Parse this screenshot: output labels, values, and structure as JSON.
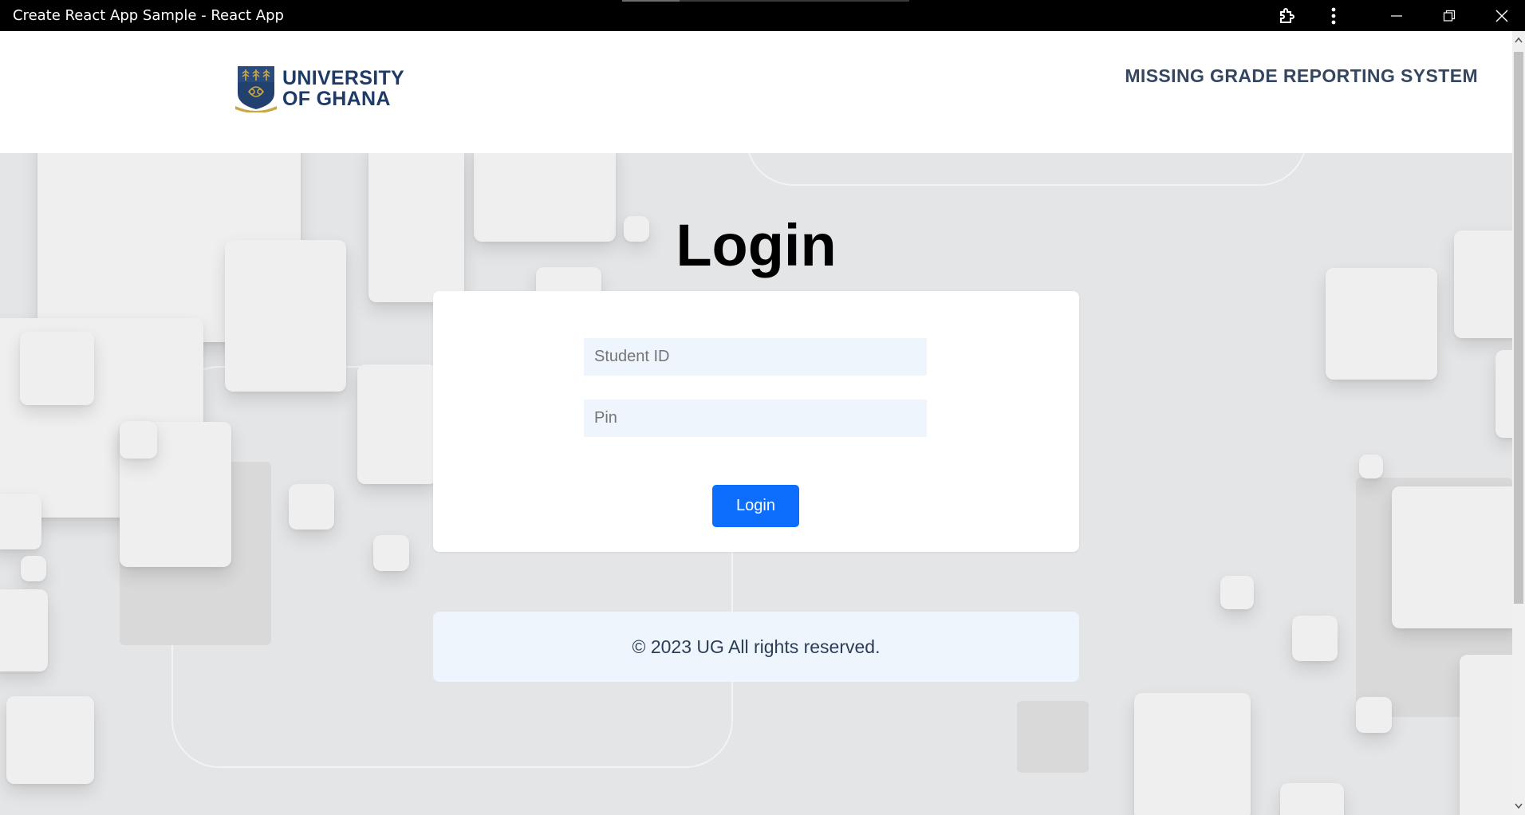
{
  "window": {
    "title": "Create React App Sample - React App",
    "icons": [
      "extensions-icon",
      "more-options-icon",
      "minimize-icon",
      "restore-icon",
      "close-icon"
    ]
  },
  "header": {
    "logo_line1": "UNIVERSITY",
    "logo_line2": "OF GHANA",
    "app_title": "MISSING GRADE REPORTING SYSTEM"
  },
  "login": {
    "heading": "Login",
    "student_id_placeholder": "Student ID",
    "pin_placeholder": "Pin",
    "button_label": "Login"
  },
  "footer": {
    "text": "© 2023 UG All rights reserved."
  },
  "colors": {
    "brand": "#1f3a66",
    "button": "#0d6efd",
    "input_bg": "#eef5fd",
    "footer_bg": "#eef5fd"
  }
}
